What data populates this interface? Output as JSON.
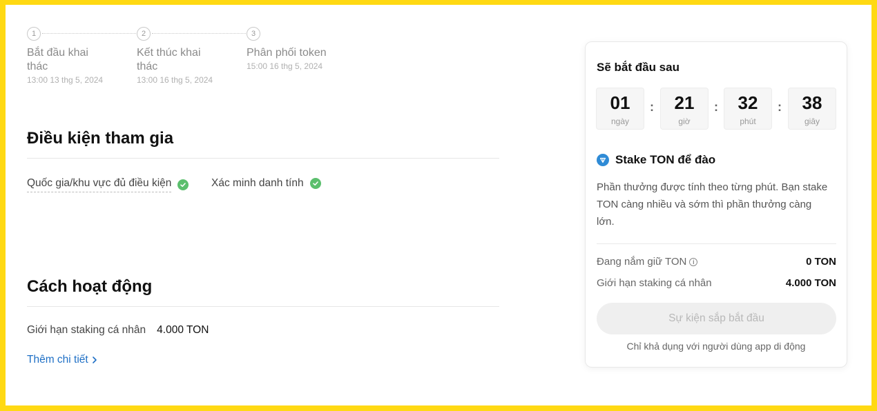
{
  "steps": [
    {
      "number": "1",
      "title": "Bắt đầu khai thác",
      "time": "13:00 13 thg 5, 2024"
    },
    {
      "number": "2",
      "title": "Kết thúc khai thác",
      "time": "13:00 16 thg 5, 2024"
    },
    {
      "number": "3",
      "title": "Phân phối token",
      "time": "15:00 16 thg 5, 2024"
    }
  ],
  "conditions": {
    "title": "Điều kiện tham gia",
    "items": [
      {
        "label": "Quốc gia/khu vực đủ điều kiện",
        "status": "check-icon"
      },
      {
        "label": "Xác minh danh tính",
        "status": "check-icon"
      }
    ]
  },
  "how_it_works": {
    "title": "Cách hoạt động",
    "limit_label": "Giới hạn staking cá nhân",
    "limit_value": "4.000 TON",
    "more_link": "Thêm chi tiết"
  },
  "card": {
    "title": "Sẽ bắt đầu sau",
    "countdown": [
      {
        "value": "01",
        "unit": "ngày"
      },
      {
        "value": "21",
        "unit": "giờ"
      },
      {
        "value": "32",
        "unit": "phút"
      },
      {
        "value": "38",
        "unit": "giây"
      }
    ],
    "stake_title": "Stake TON để đào",
    "description": "Phần thưởng được tính theo từng phút. Bạn stake TON càng nhiều và sớm thì phần thưởng càng lớn.",
    "holding_label": "Đang nắm giữ TON",
    "holding_value": "0 TON",
    "limit_label": "Giới hạn staking cá nhân",
    "limit_value": "4.000 TON",
    "button_label": "Sự kiện sắp bắt đầu",
    "note": "Chỉ khả dụng với người dùng app di động"
  },
  "colors": {
    "frame": "#FFD913",
    "check": "#5bbf6d",
    "link": "#1e6fc5",
    "ton": "#2f8bd6"
  }
}
